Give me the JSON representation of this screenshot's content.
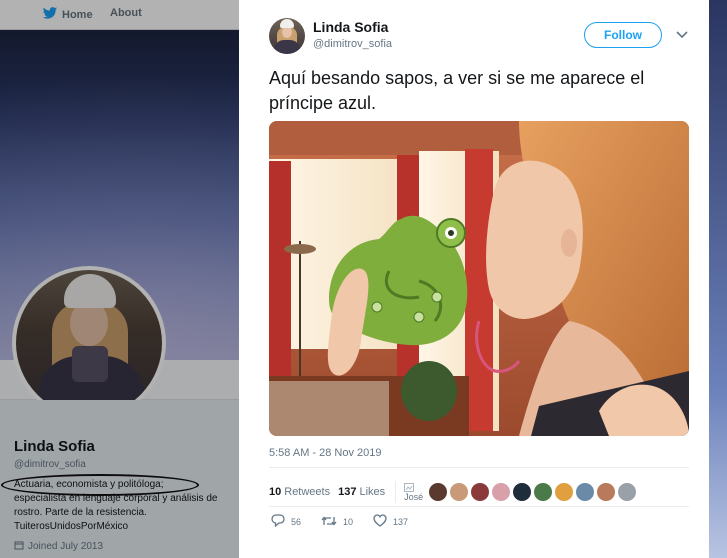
{
  "nav": {
    "home_label": "Home",
    "about_label": "About"
  },
  "profile": {
    "name": "Linda Sofia",
    "handle": "@dimitrov_sofia",
    "bio_line1": "Actuaria, economista y politóloga;",
    "bio_line2": "especialista en lenguaje corporal y análisis de",
    "bio_line3": "rostro. Parte de la resistencia.",
    "bio_line4": "TuiterosUnidosPorMéxico",
    "joined": "Joined July 2013"
  },
  "tweet": {
    "author_name": "Linda Sofia",
    "author_handle": "@dimitrov_sofia",
    "follow_label": "Follow",
    "text": "Aquí besando sapos, a ver si se me aparece el príncipe azul.",
    "timestamp": "5:58 AM - 28 Nov 2019",
    "retweets_count": "10",
    "retweets_label": "Retweets",
    "likes_count": "137",
    "likes_label": "Likes",
    "liker_preview_name": "José",
    "reply_count": "56",
    "retweet_count": "10",
    "like_count": "137"
  },
  "colors": {
    "accent": "#1da1f2",
    "text": "#14171a",
    "muted": "#657786",
    "frog": "#7fae3c"
  },
  "icons": [
    "twitter-bird-icon",
    "chevron-down-icon",
    "reply-icon",
    "retweet-icon",
    "heart-icon",
    "calendar-icon"
  ]
}
